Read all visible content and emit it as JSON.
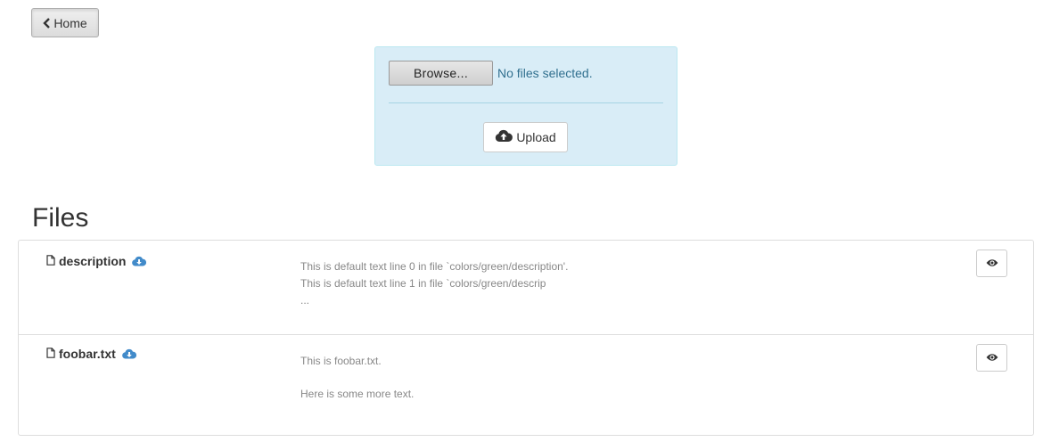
{
  "nav": {
    "home_label": "Home"
  },
  "upload": {
    "browse_label": "Browse...",
    "file_status": "No files selected.",
    "upload_label": "Upload"
  },
  "files_heading": "Files",
  "files": [
    {
      "name": "description",
      "preview_lines": [
        "This is default text line 0 in file `colors/green/description'.",
        "This is default text line 1 in file `colors/green/descrip",
        "..."
      ]
    },
    {
      "name": "foobar.txt",
      "preview_lines": [
        "This is foobar.txt.",
        "Here is some more text."
      ]
    }
  ],
  "colors": {
    "panel_bg": "#d9edf7",
    "info_text": "#31708f",
    "download_icon": "#428bca"
  },
  "icons": {
    "home": "chevron-left-icon",
    "upload": "cloud-upload-icon",
    "file": "file-icon",
    "download": "cloud-download-icon",
    "view": "eye-icon"
  }
}
